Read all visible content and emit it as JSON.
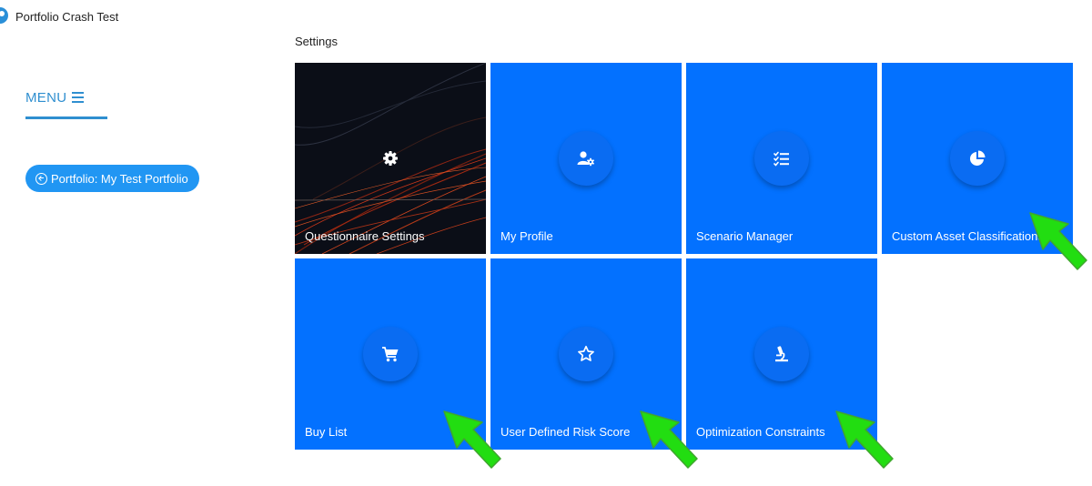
{
  "app": {
    "title": "Portfolio Crash Test"
  },
  "sidebar": {
    "menu_label": "MENU",
    "portfolio_button": "Portfolio: My Test Portfolio"
  },
  "main": {
    "heading": "Settings",
    "tiles": [
      {
        "label": "Questionnaire Settings",
        "icon": "gear-icon"
      },
      {
        "label": "My Profile",
        "icon": "user-cog-icon"
      },
      {
        "label": "Scenario Manager",
        "icon": "checklist-icon"
      },
      {
        "label": "Custom Asset Classifications",
        "icon": "pie-chart-icon"
      },
      {
        "label": "Buy List",
        "icon": "shopping-cart-icon"
      },
      {
        "label": "User Defined Risk Score",
        "icon": "star-icon"
      },
      {
        "label": "Optimization Constraints",
        "icon": "microscope-icon"
      }
    ]
  },
  "colors": {
    "tile_blue": "#0371ff",
    "accent": "#2f8fd0",
    "button_blue": "#2196f3",
    "annotation_arrow": "#22dd11"
  }
}
